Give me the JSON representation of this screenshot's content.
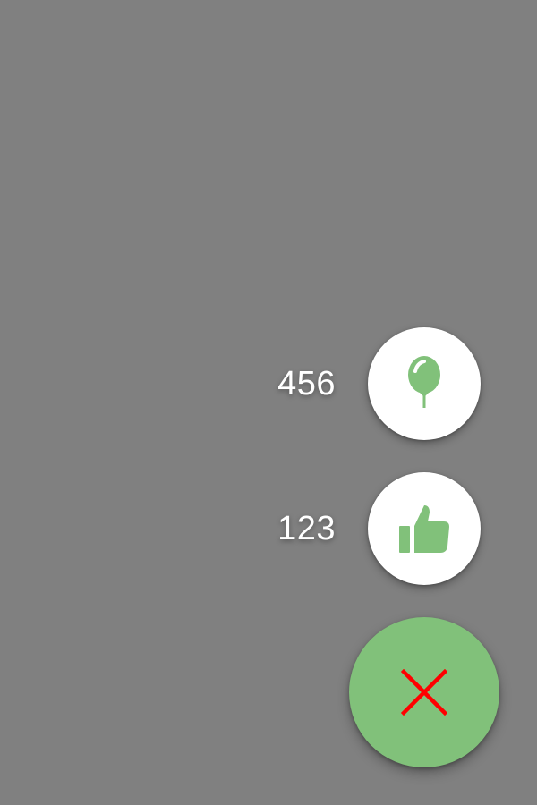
{
  "background_color": "#808080",
  "speed_dial": {
    "actions": [
      {
        "id": "balloon",
        "count": "456",
        "icon": "balloon-icon"
      },
      {
        "id": "like",
        "count": "123",
        "icon": "thumbs-up-icon"
      }
    ],
    "main_button": {
      "icon": "close-icon"
    }
  },
  "colors": {
    "accent": "#81c17a",
    "mini_fab_bg": "#ffffff",
    "close_icon": "#ff0000",
    "label_text": "#ffffff"
  }
}
